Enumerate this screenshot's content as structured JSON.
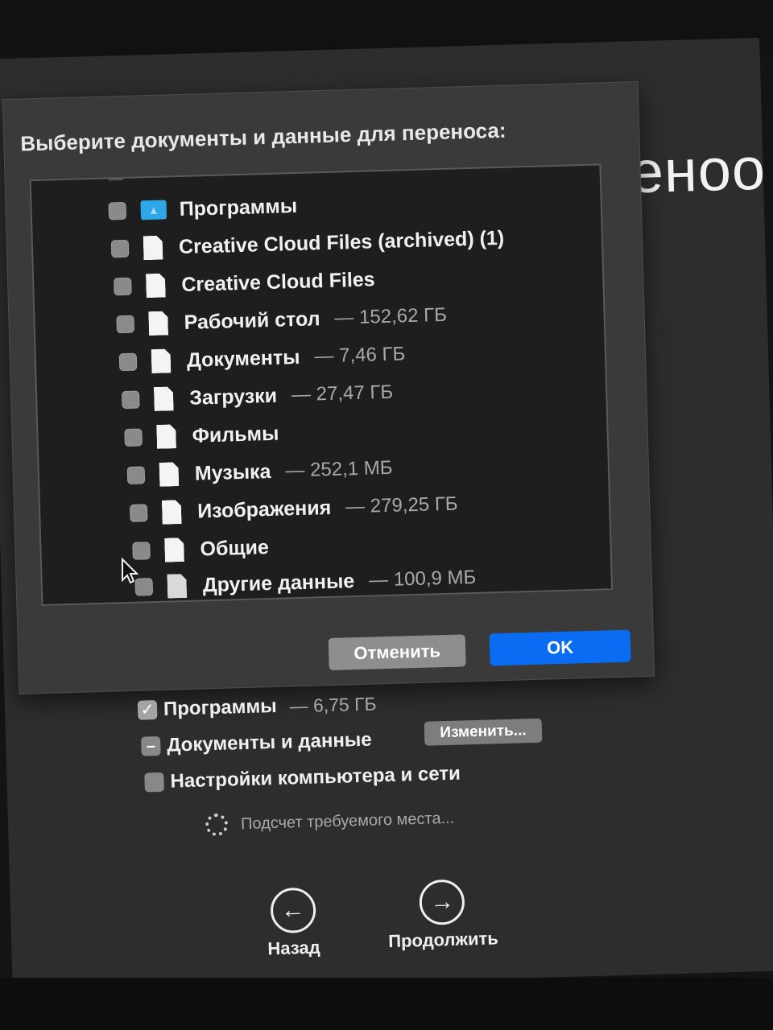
{
  "background": {
    "title_fragment": "еноо"
  },
  "dialog": {
    "title": "Выберите документы и данные для переноса:",
    "items": [
      {
        "label": "Программы",
        "size": "",
        "icon": "app-folder-icon"
      },
      {
        "label": "Creative Cloud Files (archived) (1)",
        "size": "",
        "icon": "file-icon"
      },
      {
        "label": "Creative Cloud Files",
        "size": "",
        "icon": "file-icon"
      },
      {
        "label": "Рабочий стол",
        "size": "— 152,62 ГБ",
        "icon": "file-icon"
      },
      {
        "label": "Документы",
        "size": "— 7,46 ГБ",
        "icon": "file-icon"
      },
      {
        "label": "Загрузки",
        "size": "— 27,47 ГБ",
        "icon": "file-icon"
      },
      {
        "label": "Фильмы",
        "size": "",
        "icon": "file-icon"
      },
      {
        "label": "Музыка",
        "size": "— 252,1 МБ",
        "icon": "file-icon"
      },
      {
        "label": "Изображения",
        "size": "— 279,25 ГБ",
        "icon": "file-icon"
      },
      {
        "label": "Общие",
        "size": "",
        "icon": "file-icon"
      },
      {
        "label": "Другие данные",
        "size": "— 100,9 МБ",
        "icon": "file-icon"
      }
    ],
    "cancel_label": "Отменить",
    "ok_label": "OK"
  },
  "options": {
    "apps_label": "Программы",
    "apps_size": "— 6,75 ГБ",
    "apps_state": "checked",
    "docs_label": "Документы и данные",
    "docs_state": "mixed",
    "change_label": "Изменить...",
    "settings_label": "Настройки компьютера и сети",
    "settings_state": "unchecked"
  },
  "status": {
    "calculating": "Подсчет требуемого места..."
  },
  "nav": {
    "back_label": "Назад",
    "continue_label": "Продолжить"
  },
  "colors": {
    "accent": "#0a6cf2",
    "background": "#2d2d2d",
    "sheet": "#3a3a3a",
    "list": "#1e1e1e"
  }
}
